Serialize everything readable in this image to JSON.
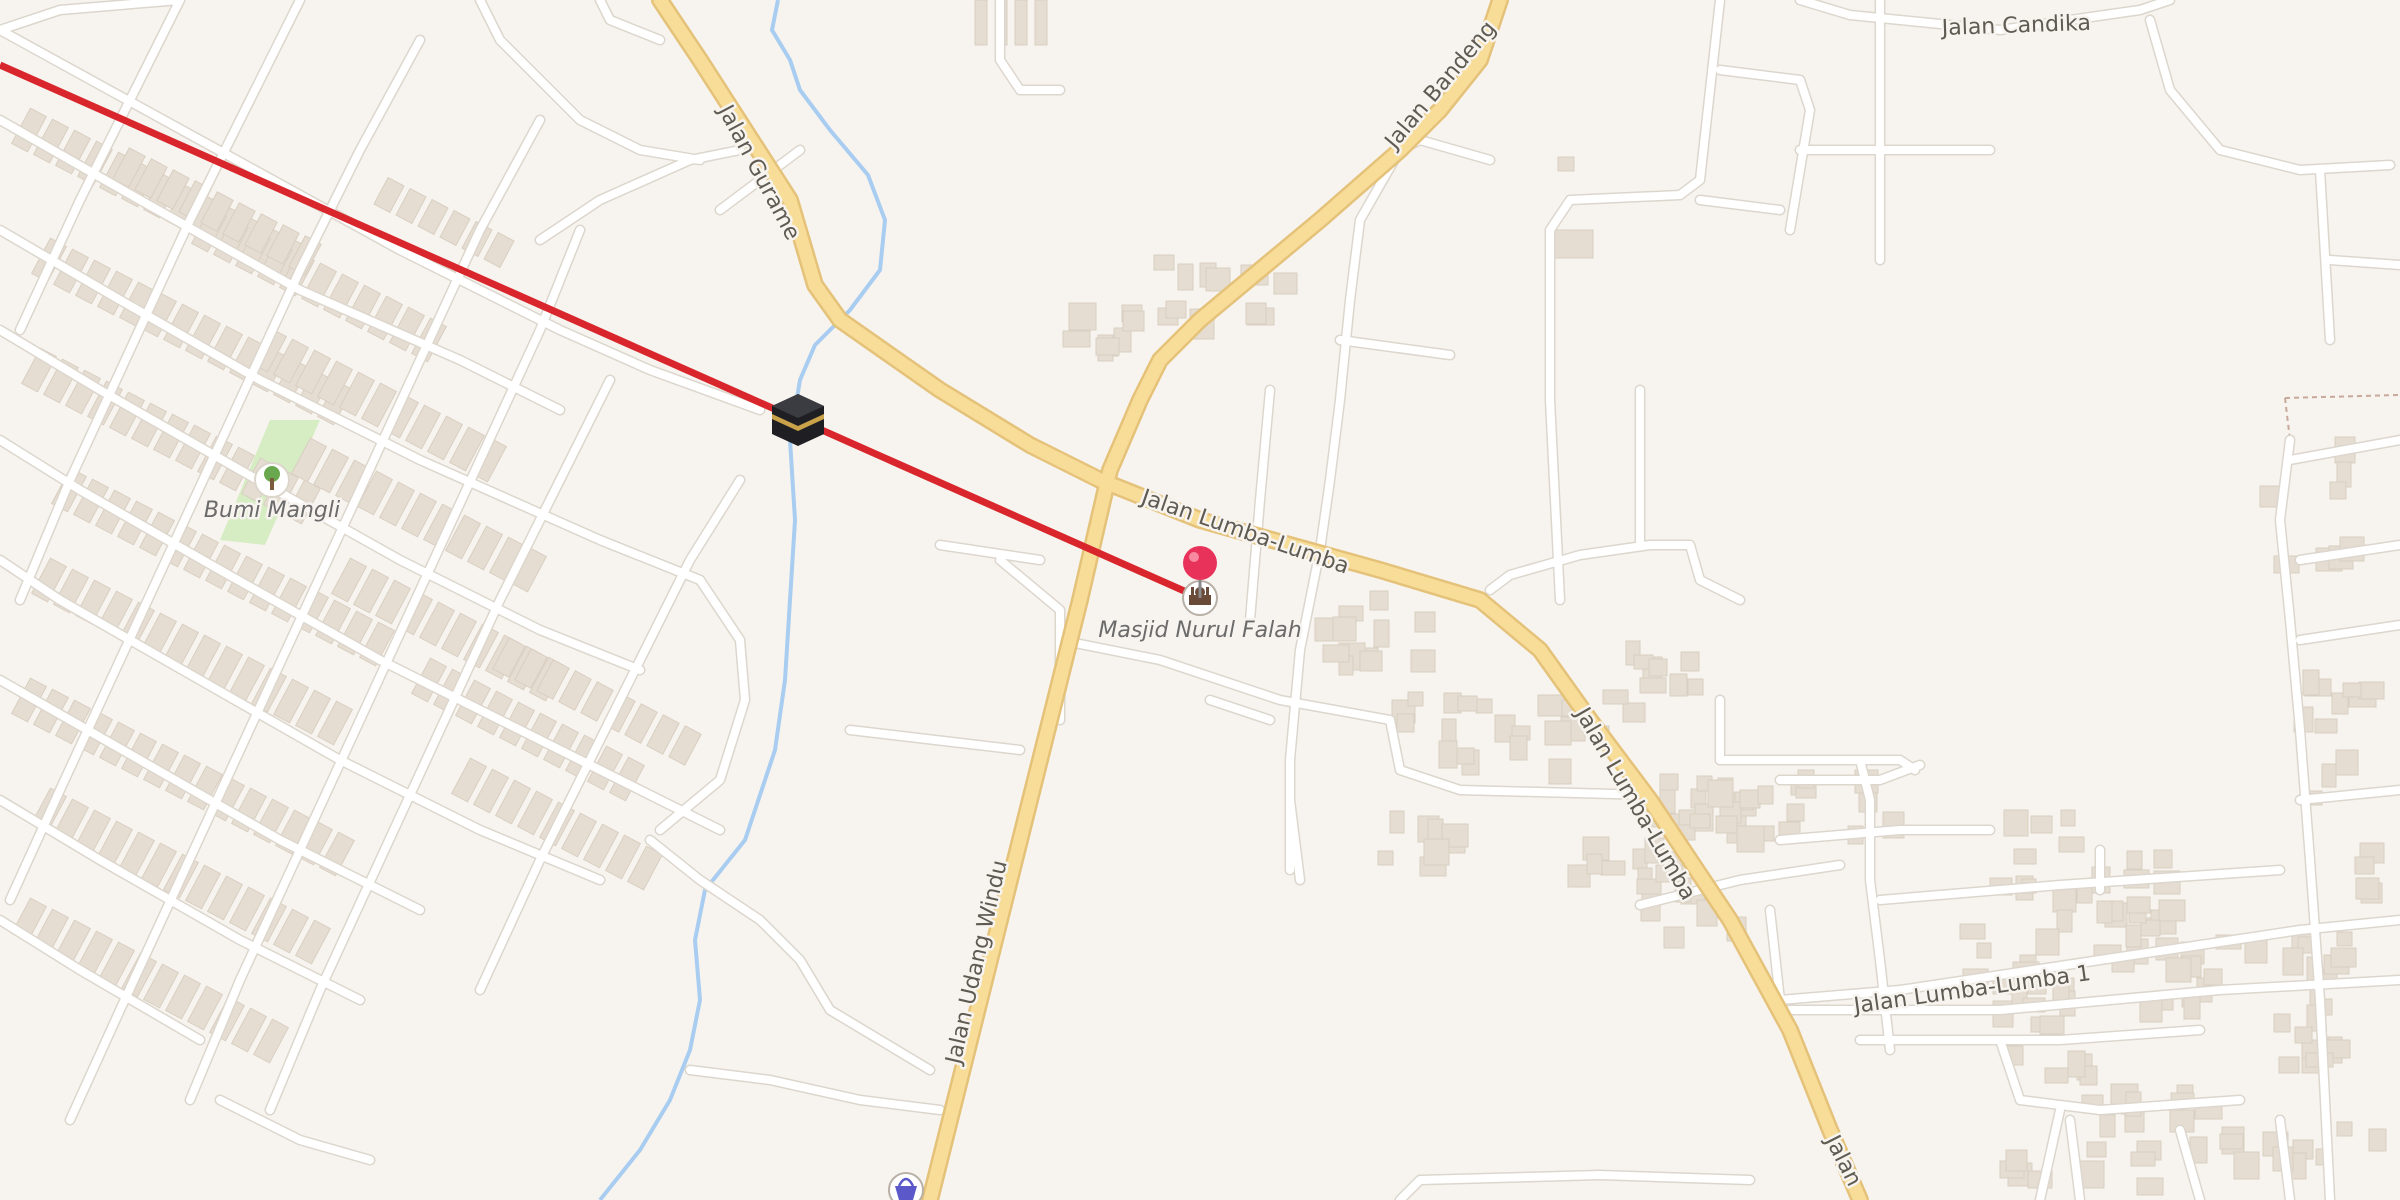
{
  "map": {
    "road_labels": {
      "candika": "Jalan Candika",
      "gurame": "Jalan Gurame",
      "bandeng": "Jalan Bandeng",
      "lumba_lumba_horizontal": "Jalan Lumba-Lumba",
      "lumba_lumba_diagonal": "Jalan Lumba-Lumba",
      "lumba_lumba_1": "Jalan Lumba-Lumba 1",
      "udang_windu": "Jalan Udang Windu",
      "lumba_cut": "Jalan"
    },
    "pois": {
      "park": {
        "label": "Bumi Mangli",
        "icon": "tree-icon"
      },
      "mosque": {
        "label": "Masjid Nurul Falah",
        "icon": "mosque-icon"
      },
      "kaaba": {
        "icon": "kaaba-icon"
      },
      "pin": {
        "icon": "location-pin-icon",
        "color": "#e8325a"
      },
      "shop": {
        "icon": "shopping-basket-icon"
      }
    },
    "qibla_line": {
      "color": "#d8262c"
    },
    "colors": {
      "background": "#f7f4ef",
      "major_road": "#f7dd98",
      "major_road_casing": "#e5c27a",
      "minor_road": "#ffffff",
      "minor_road_casing": "#dcd6cd",
      "building": "#e6ddd2",
      "river": "#a9cdf0",
      "park": "#d6ecc2"
    }
  }
}
